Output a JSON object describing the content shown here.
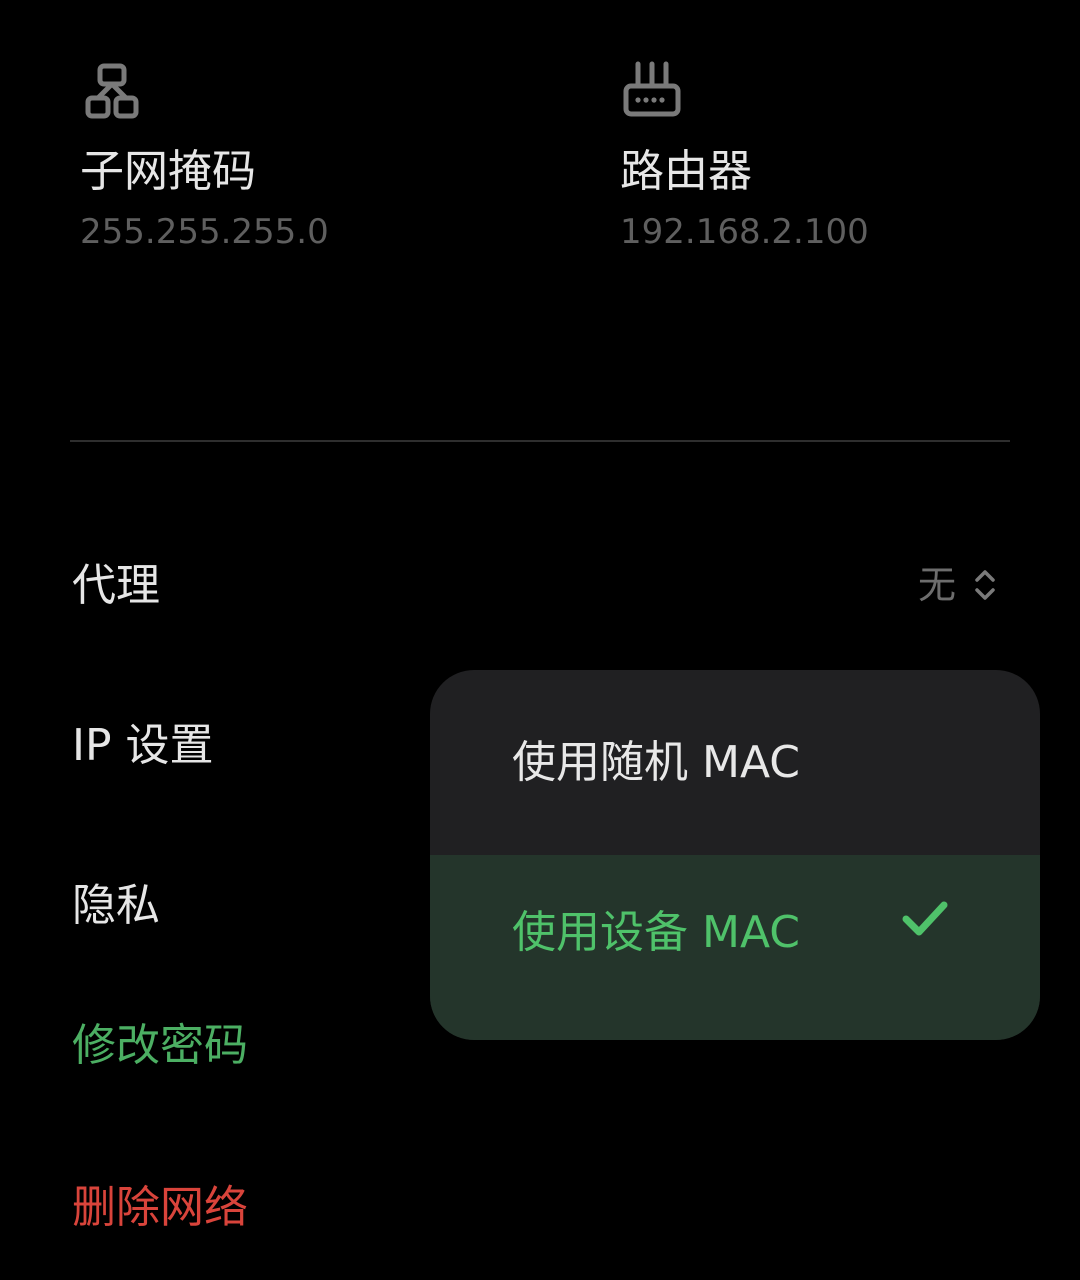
{
  "subnet": {
    "icon": "network-topology-icon",
    "title": "子网掩码",
    "value": "255.255.255.0"
  },
  "router": {
    "icon": "router-icon",
    "title": "路由器",
    "value": "192.168.2.100"
  },
  "proxy": {
    "label": "代理",
    "value": "无",
    "icon": "up-down-chevron-icon"
  },
  "ip_settings": {
    "label": "IP 设置"
  },
  "privacy": {
    "label": "隐私"
  },
  "change_password": {
    "label": "修改密码"
  },
  "delete_network": {
    "label": "删除网络"
  },
  "mac_menu": {
    "options": [
      {
        "label": "使用随机 MAC",
        "selected": false
      },
      {
        "label": "使用设备 MAC",
        "selected": true
      }
    ],
    "check_icon": "checkmark-icon"
  },
  "colors": {
    "background": "#000000",
    "accent_green": "#4caf63",
    "danger_red": "#d9443b",
    "popup_bg": "#202022",
    "selected_bg": "#24352b"
  }
}
